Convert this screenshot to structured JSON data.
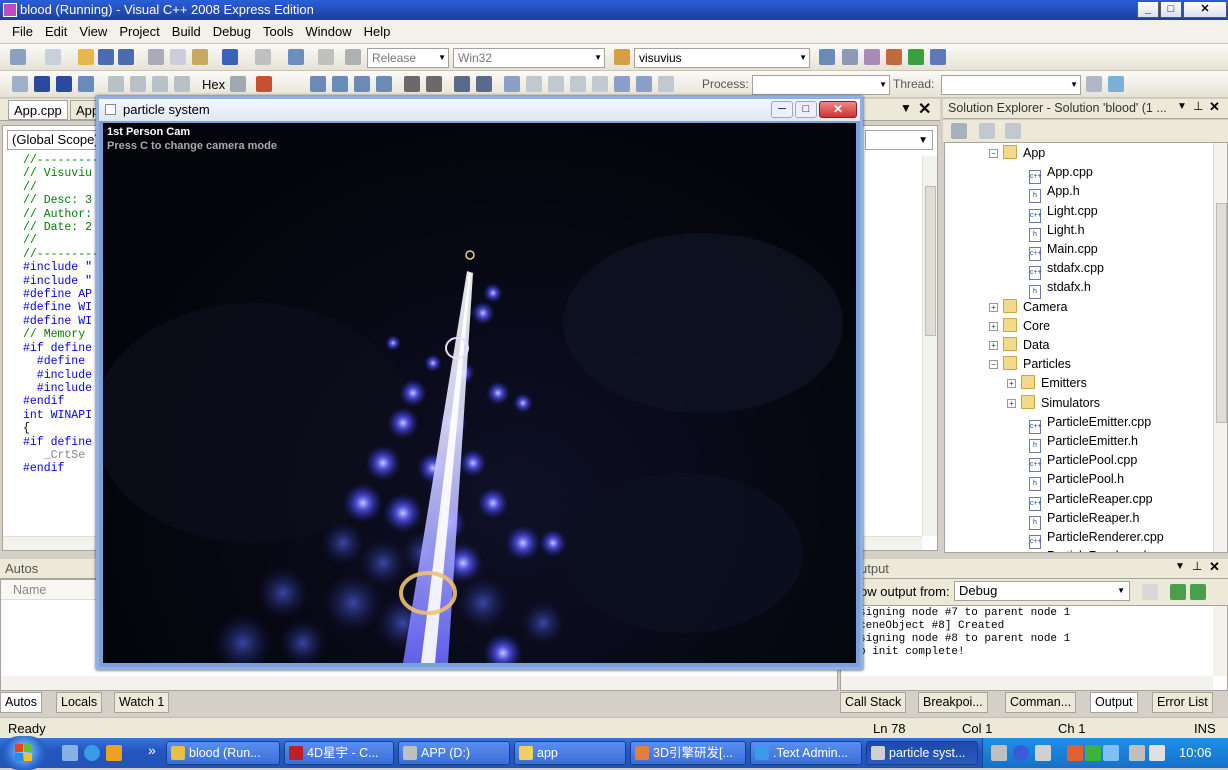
{
  "titlebar": {
    "title": "blood (Running) - Visual C++ 2008 Express Edition"
  },
  "menu": [
    "File",
    "Edit",
    "View",
    "Project",
    "Build",
    "Debug",
    "Tools",
    "Window",
    "Help"
  ],
  "toolbar": {
    "config": "Release",
    "platform": "Win32",
    "find": "visuvius",
    "hex": "Hex",
    "process_label": "Process:",
    "thread_label": "Thread:"
  },
  "editor": {
    "tabs": [
      "App.cpp",
      "App"
    ],
    "scope": "(Global Scope)",
    "lines": [
      "//----------",
      "// Visuviu",
      "//",
      "// Desc: 3",
      "// Author:",
      "// Date: 2",
      "//",
      "//----------",
      "#include \"",
      "#include \"",
      "",
      "#define AP",
      "#define WI",
      "#define WI",
      "",
      "// Memory",
      "#if define",
      "  #define",
      "  #include",
      "  #include",
      "#endif",
      "",
      "int WINAPI",
      "{",
      "#if define",
      "   _CrtSe",
      "#endif"
    ]
  },
  "solution": {
    "title": "Solution Explorer - Solution 'blood' (1 ...",
    "items": [
      {
        "label": "App",
        "type": "folder",
        "open": true,
        "level": 0
      },
      {
        "label": "App.cpp",
        "type": "cpp",
        "level": 1
      },
      {
        "label": "App.h",
        "type": "h",
        "level": 1
      },
      {
        "label": "Light.cpp",
        "type": "cpp",
        "level": 1
      },
      {
        "label": "Light.h",
        "type": "h",
        "level": 1
      },
      {
        "label": "Main.cpp",
        "type": "cpp",
        "level": 1
      },
      {
        "label": "stdafx.cpp",
        "type": "cpp",
        "level": 1
      },
      {
        "label": "stdafx.h",
        "type": "h",
        "level": 1
      },
      {
        "label": "Camera",
        "type": "folder",
        "open": false,
        "level": 0
      },
      {
        "label": "Core",
        "type": "folder",
        "open": false,
        "level": 0
      },
      {
        "label": "Data",
        "type": "folder",
        "open": false,
        "level": 0
      },
      {
        "label": "Particles",
        "type": "folder",
        "open": true,
        "level": 0
      },
      {
        "label": "Emitters",
        "type": "folder",
        "open": false,
        "level": 1
      },
      {
        "label": "Simulators",
        "type": "folder",
        "open": false,
        "level": 1
      },
      {
        "label": "ParticleEmitter.cpp",
        "type": "cpp",
        "level": 1
      },
      {
        "label": "ParticleEmitter.h",
        "type": "h",
        "level": 1
      },
      {
        "label": "ParticlePool.cpp",
        "type": "cpp",
        "level": 1
      },
      {
        "label": "ParticlePool.h",
        "type": "h",
        "level": 1
      },
      {
        "label": "ParticleReaper.cpp",
        "type": "cpp",
        "level": 1
      },
      {
        "label": "ParticleReaper.h",
        "type": "h",
        "level": 1
      },
      {
        "label": "ParticleRenderer.cpp",
        "type": "cpp",
        "level": 1
      },
      {
        "label": "ParticleRenderer.h",
        "type": "h",
        "level": 1
      }
    ]
  },
  "autos": {
    "title": "Autos",
    "col_name": "Name",
    "tabs": [
      "Autos",
      "Locals",
      "Watch 1"
    ]
  },
  "output": {
    "title": "utput",
    "show_from": "ow output from:",
    "source": "Debug",
    "lines": [
      "signing node #7 to parent node 1",
      "ceneObject #8] Created",
      "signing node #8 to parent node 1",
      "p init complete!"
    ],
    "tabs": [
      "Call Stack",
      "Breakpoi...",
      "Comman...",
      "Output",
      "Error List"
    ]
  },
  "status": {
    "ready": "Ready",
    "ln": "Ln 78",
    "col": "Col 1",
    "ch": "Ch 1",
    "mode": "INS"
  },
  "particle_window": {
    "title": "particle system",
    "cam": "1st Person Cam",
    "hint": "Press C to change camera mode"
  },
  "taskbar": {
    "items": [
      "blood (Run...",
      "4D星宇 - C...",
      "APP (D:)",
      "app",
      "3D引擎研发[...",
      ".Text Admin...",
      "particle syst..."
    ],
    "clock": "10:06",
    "chevron": "»"
  }
}
